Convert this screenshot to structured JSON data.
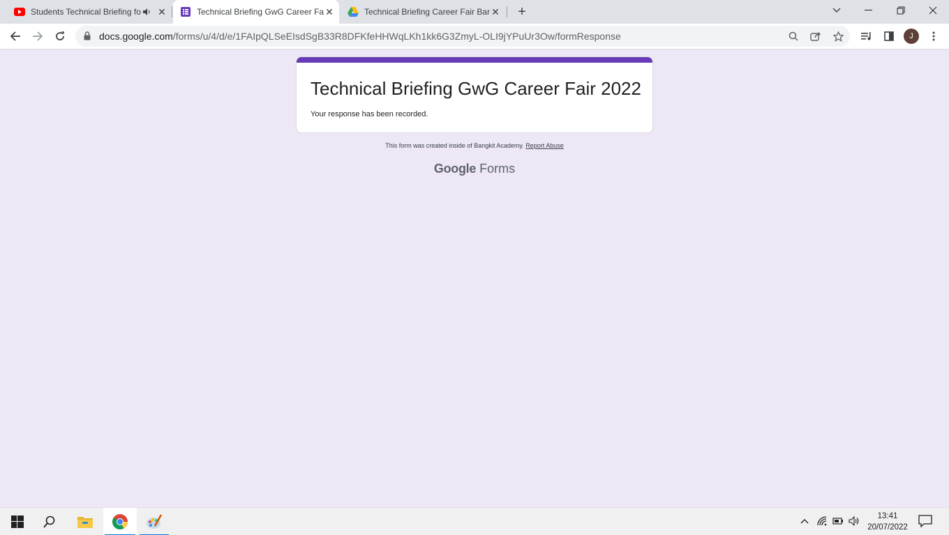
{
  "browser": {
    "tabs": [
      {
        "title": "Students Technical Briefing for",
        "favicon": "youtube-icon",
        "audio": true,
        "active": false
      },
      {
        "title": "Technical Briefing GwG Career Fair",
        "favicon": "google-forms-icon",
        "active": true
      },
      {
        "title": "Technical Briefing Career Fair Bangkit",
        "favicon": "google-drive-icon",
        "active": false
      }
    ],
    "url_host": "docs.google.com",
    "url_path": "/forms/u/4/d/e/1FAIpQLSeEIsdSgB33R8DFKfeHHWqLKh1kk6G3ZmyL-OLI9jYPuUr3Ow/formResponse",
    "profile_initial": "J"
  },
  "form": {
    "title": "Technical Briefing GwG Career Fair 2022",
    "confirmation": "Your response has been recorded.",
    "footer_text": "This form was created inside of Bangkit Academy.",
    "report_link": "Report Abuse",
    "brand_google": "Google",
    "brand_forms": "Forms",
    "accent_color": "#673ab7",
    "background_color": "#ede7f6"
  },
  "taskbar": {
    "time": "13:41",
    "date": "20/07/2022",
    "apps": [
      "start-icon",
      "search-icon",
      "file-explorer-icon",
      "chrome-icon",
      "paint-icon"
    ]
  }
}
